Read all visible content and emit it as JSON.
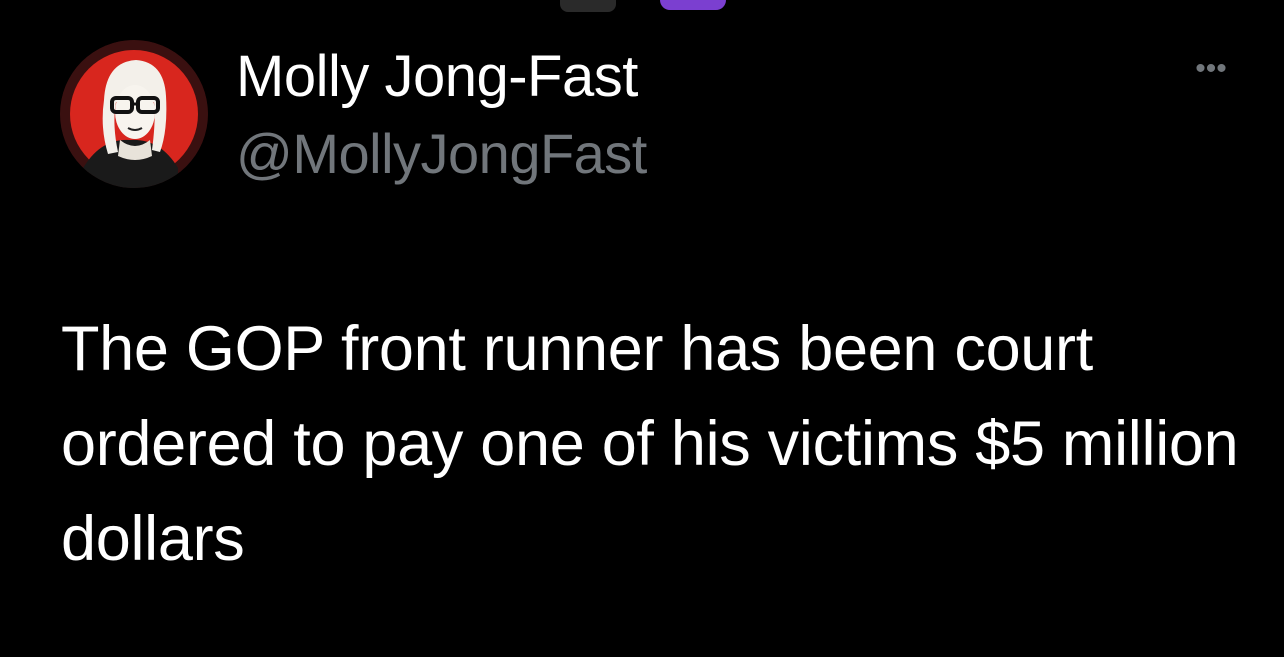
{
  "tweet": {
    "author": {
      "display_name": "Molly Jong-Fast",
      "handle": "@MollyJongFast",
      "avatar_icon": "avatar-portrait"
    },
    "more_icon": "more-horizontal-icon",
    "more_glyph": "•••",
    "text": "The GOP front runner has been court ordered to pay one of his victims $5 million dollars"
  },
  "colors": {
    "background": "#000000",
    "primary_text": "#ffffff",
    "secondary_text": "#71767b",
    "avatar_accent": "#d8261e",
    "badge": "#7b3fd0"
  }
}
